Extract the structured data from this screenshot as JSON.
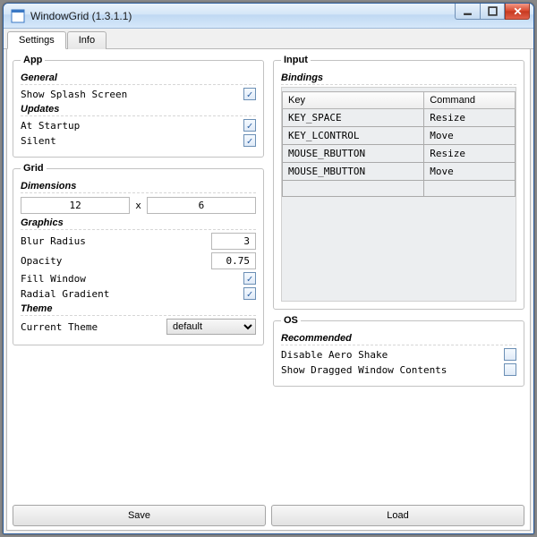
{
  "window": {
    "title": "WindowGrid (1.3.1.1)"
  },
  "tabs": {
    "settings": "Settings",
    "info": "Info",
    "active": "settings"
  },
  "app": {
    "legend": "App",
    "general": {
      "heading": "General",
      "show_splash": {
        "label": "Show Splash Screen",
        "checked": true
      }
    },
    "updates": {
      "heading": "Updates",
      "at_startup": {
        "label": "At Startup",
        "checked": true
      },
      "silent": {
        "label": "Silent",
        "checked": true
      }
    }
  },
  "grid": {
    "legend": "Grid",
    "dimensions": {
      "heading": "Dimensions",
      "cols": "12",
      "sep": "x",
      "rows": "6"
    },
    "graphics": {
      "heading": "Graphics",
      "blur_radius": {
        "label": "Blur Radius",
        "value": "3"
      },
      "opacity": {
        "label": "Opacity",
        "value": "0.75"
      },
      "fill_window": {
        "label": "Fill Window",
        "checked": true
      },
      "radial_gradient": {
        "label": "Radial Gradient",
        "checked": true
      }
    },
    "theme": {
      "heading": "Theme",
      "current_label": "Current Theme",
      "value": "default"
    }
  },
  "input": {
    "legend": "Input",
    "bindings": {
      "heading": "Bindings",
      "headers": {
        "key": "Key",
        "command": "Command"
      },
      "rows": [
        {
          "key": "KEY_SPACE",
          "command": "Resize"
        },
        {
          "key": "KEY_LCONTROL",
          "command": "Move"
        },
        {
          "key": "MOUSE_RBUTTON",
          "command": "Resize"
        },
        {
          "key": "MOUSE_MBUTTON",
          "command": "Move"
        },
        {
          "key": "",
          "command": ""
        }
      ]
    }
  },
  "os": {
    "legend": "OS",
    "recommended": {
      "heading": "Recommended",
      "disable_aero_shake": {
        "label": "Disable Aero Shake",
        "checked": false
      },
      "show_dragged": {
        "label": "Show Dragged Window Contents",
        "checked": false
      }
    }
  },
  "buttons": {
    "save": "Save",
    "load": "Load"
  }
}
